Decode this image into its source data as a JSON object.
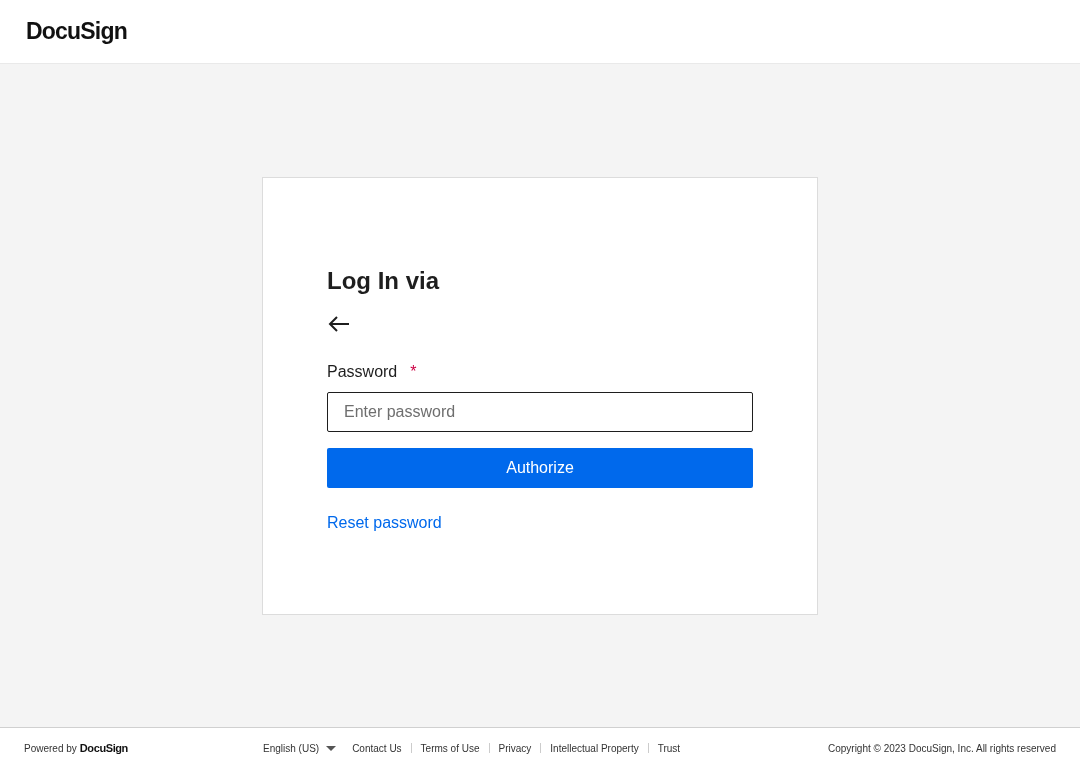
{
  "header": {
    "logo": "DocuSign"
  },
  "login": {
    "title": "Log In via",
    "password_label": "Password",
    "required_mark": "*",
    "password_placeholder": "Enter password",
    "authorize_button": "Authorize",
    "reset_link": "Reset password"
  },
  "footer": {
    "powered_by": "Powered by",
    "powered_logo": "DocuSign",
    "language": "English (US)",
    "links": [
      "Contact Us",
      "Terms of Use",
      "Privacy",
      "Intellectual Property",
      "Trust"
    ],
    "copyright": "Copyright © 2023 DocuSign, Inc. All rights reserved"
  }
}
